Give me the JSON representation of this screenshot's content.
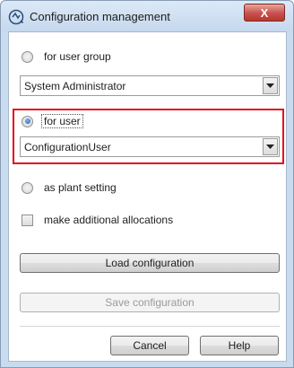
{
  "window": {
    "title": "Configuration management",
    "close_glyph": "X"
  },
  "options": {
    "user_group": {
      "label": "for user group",
      "checked": false,
      "combo_value": "System Administrator"
    },
    "user": {
      "label": "for user",
      "checked": true,
      "combo_value": "ConfigurationUser"
    },
    "plant": {
      "label": "as plant setting",
      "checked": false
    }
  },
  "additional_allocations": {
    "label": "make additional allocations",
    "checked": false
  },
  "buttons": {
    "load": "Load configuration",
    "save": "Save configuration",
    "cancel": "Cancel",
    "help": "Help"
  },
  "colors": {
    "highlight": "#e2101c",
    "close_button": "#c75050"
  }
}
